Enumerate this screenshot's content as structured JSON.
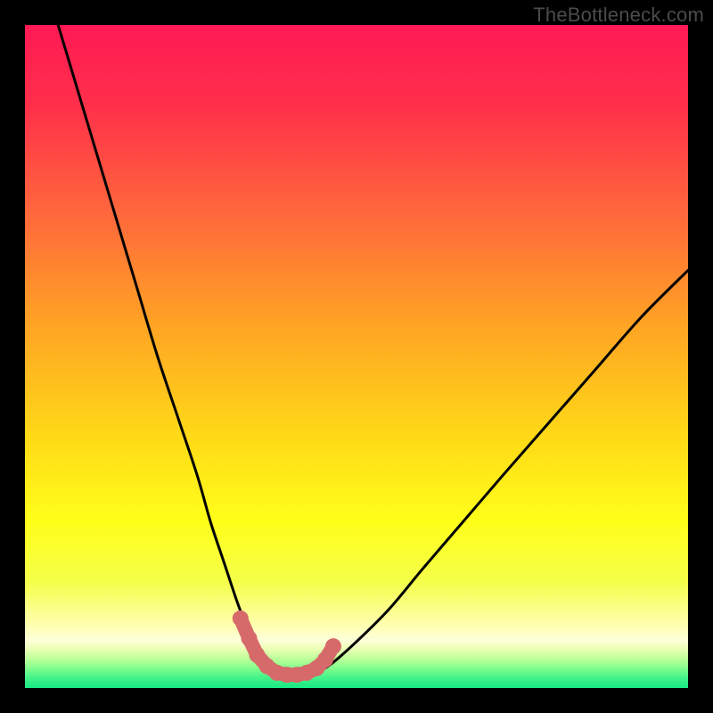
{
  "watermark": "TheBottleneck.com",
  "colors": {
    "frame": "#000000",
    "curve": "#000000",
    "marker": "#d66a6a",
    "gradient_stops": [
      {
        "offset": 0.0,
        "color": "#ff1a55"
      },
      {
        "offset": 0.12,
        "color": "#ff2f4a"
      },
      {
        "offset": 0.28,
        "color": "#ff663c"
      },
      {
        "offset": 0.45,
        "color": "#ffa324"
      },
      {
        "offset": 0.62,
        "color": "#ffd917"
      },
      {
        "offset": 0.75,
        "color": "#ffff1a"
      },
      {
        "offset": 0.84,
        "color": "#f4ff4a"
      },
      {
        "offset": 0.905,
        "color": "#ffffb0"
      },
      {
        "offset": 0.928,
        "color": "#fdffd9"
      },
      {
        "offset": 0.942,
        "color": "#e9ffb4"
      },
      {
        "offset": 0.955,
        "color": "#bfff9a"
      },
      {
        "offset": 0.968,
        "color": "#8cff8e"
      },
      {
        "offset": 0.982,
        "color": "#4cf58a"
      },
      {
        "offset": 1.0,
        "color": "#17e884"
      }
    ]
  },
  "chart_data": {
    "type": "line",
    "title": "",
    "xlabel": "",
    "ylabel": "",
    "xlim": [
      0,
      100
    ],
    "ylim": [
      0,
      100
    ],
    "grid": false,
    "series": [
      {
        "name": "bottleneck-curve",
        "x": [
          5,
          8,
          11,
          14,
          17,
          20,
          23,
          26,
          28,
          30,
          32,
          33.5,
          35,
          36.5,
          38,
          40,
          43,
          46,
          50,
          55,
          60,
          66,
          72,
          79,
          86,
          93,
          100
        ],
        "y": [
          100,
          90,
          80,
          70,
          60,
          50,
          41,
          32,
          25,
          19,
          13,
          9,
          5.5,
          3,
          1.5,
          1.5,
          1.8,
          3.5,
          7,
          12,
          18,
          25,
          32,
          40,
          48,
          56,
          63
        ]
      }
    ],
    "valley_markers": {
      "name": "valley-markers",
      "x": [
        32.5,
        33.8,
        35.0,
        36.5,
        38.0,
        39.5,
        41.0,
        42.5,
        44.0,
        45.3,
        46.5
      ],
      "y": [
        10.5,
        7.5,
        5.0,
        3.3,
        2.3,
        2.0,
        2.0,
        2.3,
        3.0,
        4.3,
        6.3
      ]
    }
  }
}
